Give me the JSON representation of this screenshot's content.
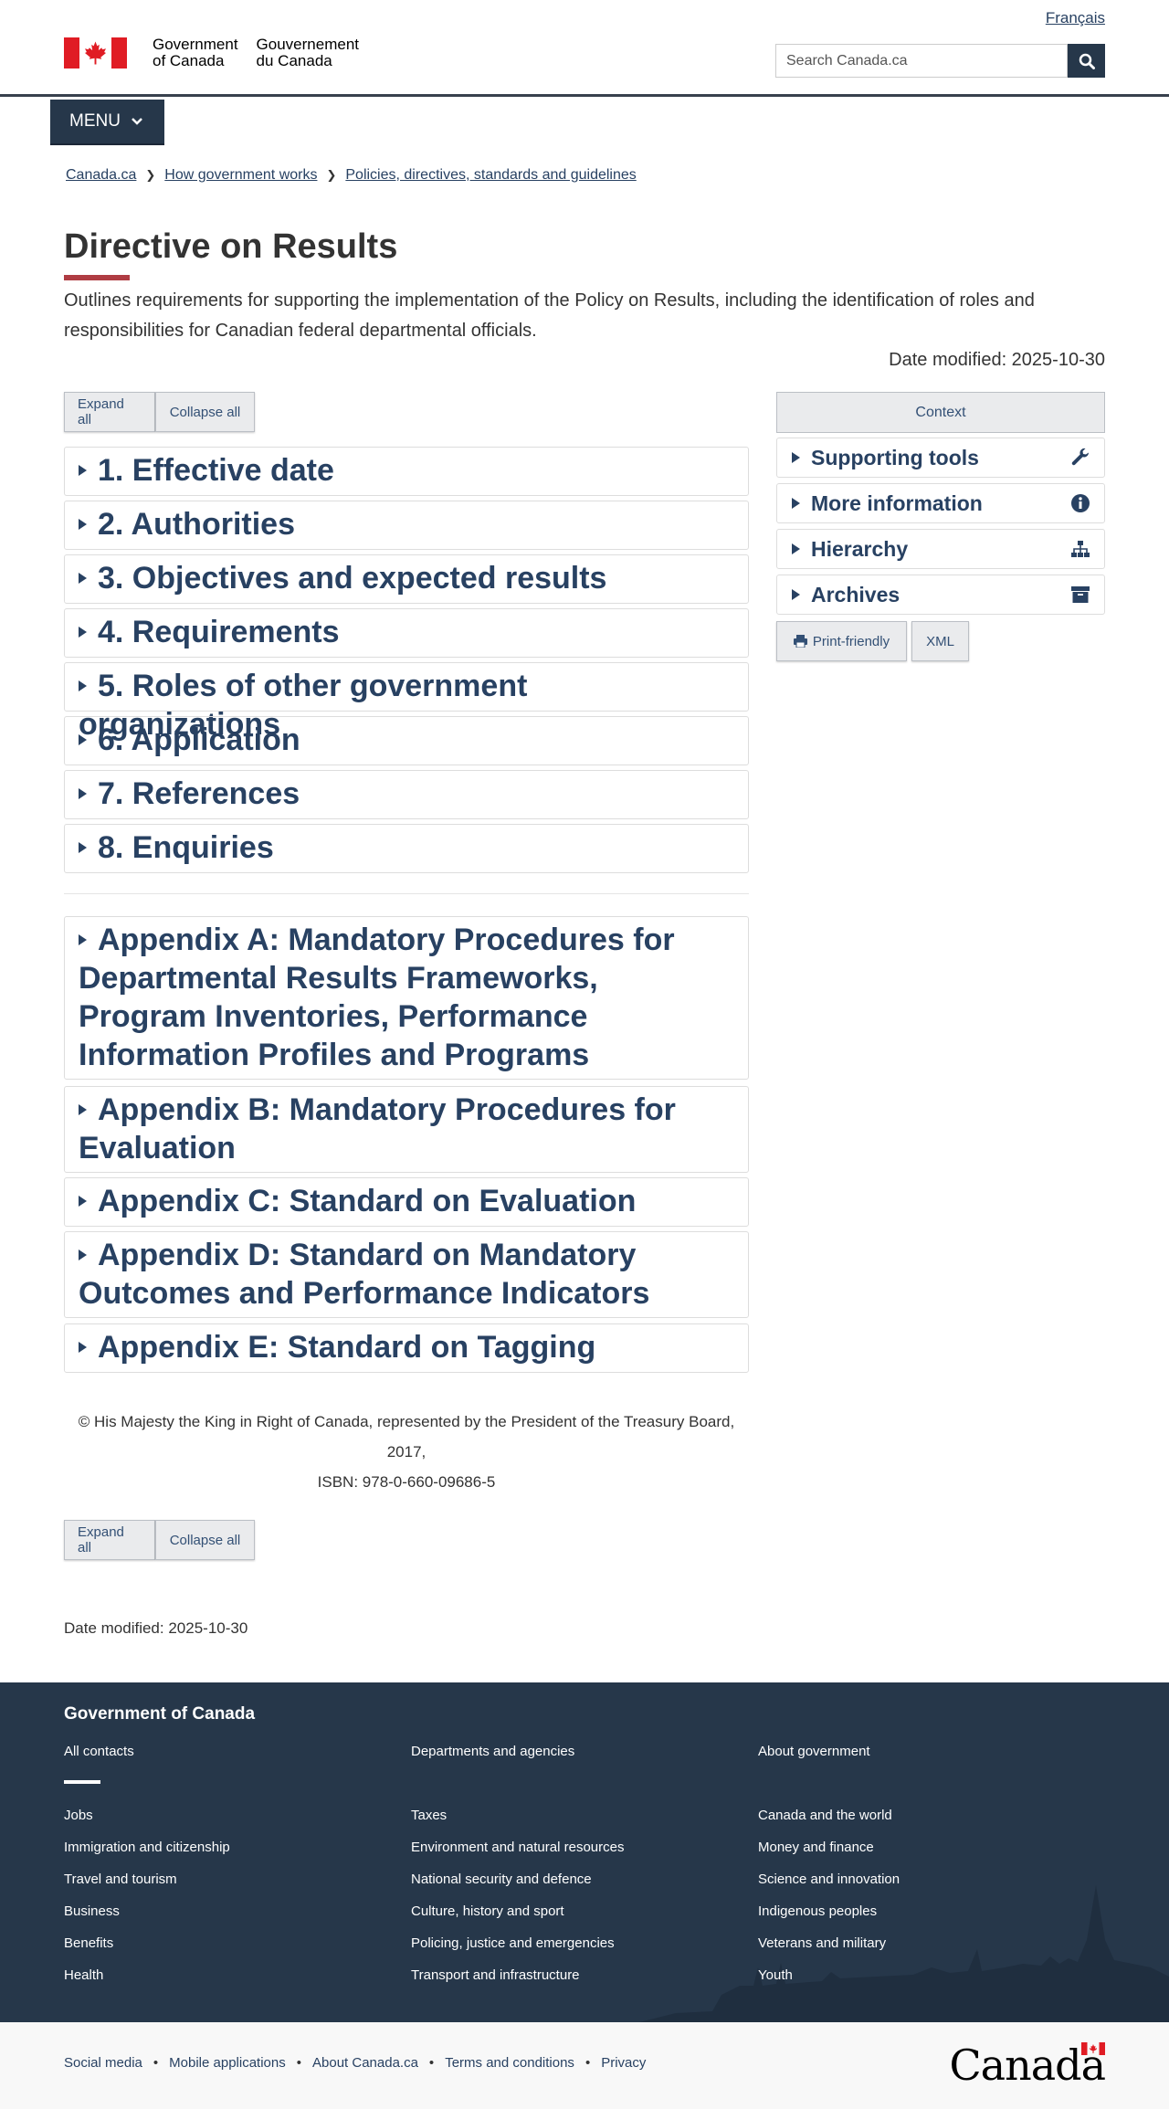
{
  "header": {
    "lang_link": "Français",
    "gov_en": "Government\nof Canada",
    "gov_fr": "Gouvernement\ndu Canada",
    "search_placeholder": "Search Canada.ca",
    "menu_label": "MENU"
  },
  "breadcrumb": [
    "Canada.ca",
    "How government works",
    "Policies, directives, standards and guidelines"
  ],
  "page": {
    "title": "Directive on Results",
    "lead": "Outlines requirements for supporting the implementation of the Policy on Results, including the identification of roles and responsibilities for Canadian federal departmental officials.",
    "date_modified": "Date modified: 2025-10-30"
  },
  "controls": {
    "expand_all": "Expand all",
    "collapse_all": "Collapse all"
  },
  "sections": [
    "1. Effective date",
    "2. Authorities",
    "3. Objectives and expected results",
    "4. Requirements",
    "5. Roles of other government organizations",
    "6. Application",
    "7. References",
    "8. Enquiries"
  ],
  "appendices": [
    "Appendix A: Mandatory Procedures for Departmental Results Frameworks, Program Inventories, Performance Information Profiles and Programs",
    "Appendix B: Mandatory Procedures for Evaluation",
    "Appendix C: Standard on Evaluation",
    "Appendix D: Standard on Mandatory Outcomes and Performance Indicators",
    "Appendix E: Standard on Tagging"
  ],
  "copyright": {
    "line1": "© His Majesty the King in Right of Canada, represented by the President of the Treasury Board, 2017,",
    "isbn": "ISBN: 978-0-660-09686-5"
  },
  "date_bottom": "Date modified: 2025-10-30",
  "sidebar": {
    "context": "Context",
    "items": [
      {
        "label": "Supporting tools",
        "icon": "wrench-icon"
      },
      {
        "label": "More information",
        "icon": "info-icon"
      },
      {
        "label": "Hierarchy",
        "icon": "sitemap-icon"
      },
      {
        "label": "Archives",
        "icon": "archive-icon"
      }
    ],
    "print_friendly": "Print-friendly",
    "xml": "XML"
  },
  "footer": {
    "title": "Government of Canada",
    "top_links": [
      "All contacts",
      "Departments and agencies",
      "About government"
    ],
    "col1": [
      "Jobs",
      "Immigration and citizenship",
      "Travel and tourism",
      "Business",
      "Benefits",
      "Health"
    ],
    "col2": [
      "Taxes",
      "Environment and natural resources",
      "National security and defence",
      "Culture, history and sport",
      "Policing, justice and emergencies",
      "Transport and infrastructure"
    ],
    "col3": [
      "Canada and the world",
      "Money and finance",
      "Science and innovation",
      "Indigenous peoples",
      "Veterans and military",
      "Youth"
    ],
    "bottom_links": [
      "Social media",
      "Mobile applications",
      "About Canada.ca",
      "Terms and conditions",
      "Privacy"
    ],
    "wordmark": "Canada"
  },
  "colors": {
    "brand_dark": "#26374a",
    "link": "#284162",
    "accent_red": "#af3c43",
    "flag_red": "#e01c24"
  }
}
